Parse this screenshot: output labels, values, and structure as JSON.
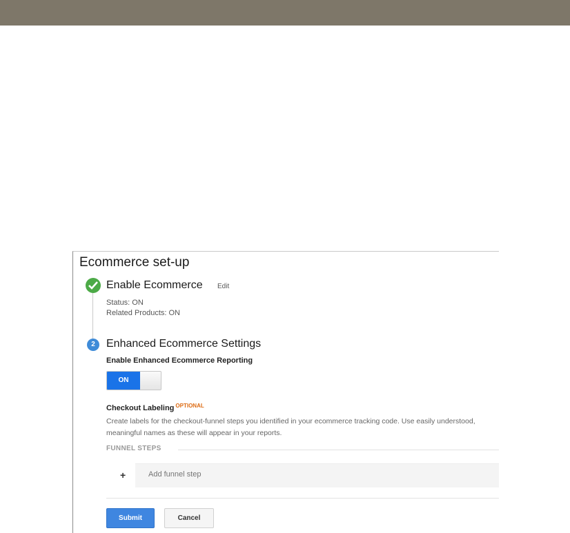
{
  "page": {
    "title": "Ecommerce set-up"
  },
  "step1": {
    "title": "Enable Ecommerce",
    "edit_label": "Edit",
    "status_line": "Status: ON",
    "related_line": "Related Products: ON",
    "icon": "check-icon",
    "color": "#4caa47"
  },
  "step2": {
    "number": "2",
    "title": "Enhanced Ecommerce Settings",
    "reporting_label": "Enable Enhanced Ecommerce Reporting",
    "toggle_label": "ON",
    "toggle_state": true,
    "color": "#3e8bd8"
  },
  "checkout": {
    "label": "Checkout Labeling",
    "optional_tag": "OPTIONAL",
    "description": "Create labels for the checkout-funnel steps you identified in your ecommerce tracking code. Use easily understood, meaningful names as these will appear in your reports.",
    "funnel_steps_label": "FUNNEL STEPS",
    "add_icon": "+",
    "add_placeholder": "Add funnel step"
  },
  "actions": {
    "submit_label": "Submit",
    "cancel_label": "Cancel"
  },
  "colors": {
    "header_bar": "#7e7769",
    "accent_blue": "#1a73e8",
    "optional_orange": "#dd6b13"
  }
}
